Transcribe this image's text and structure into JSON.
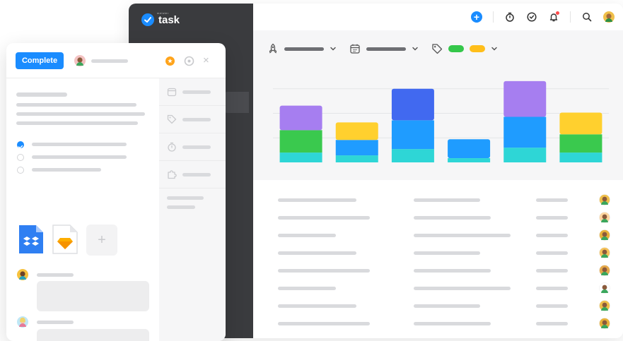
{
  "app": {
    "brand_prefix": "meister",
    "brand_name": "task"
  },
  "topbar": {
    "add_icon": "plus-circle-icon",
    "icons": [
      "timer-icon",
      "check-circle-icon",
      "bell-icon",
      "search-icon"
    ]
  },
  "filters": [
    {
      "icon": "rocket-icon"
    },
    {
      "icon": "calendar-icon"
    },
    {
      "icon": "tag-icon"
    }
  ],
  "chart_data": {
    "type": "bar",
    "stacked": true,
    "categories": [
      "",
      "",
      "",
      "",
      "",
      ""
    ],
    "series": [
      {
        "color": "#2ed6d6",
        "values": [
          14,
          10,
          19,
          6,
          21,
          14
        ]
      },
      {
        "color": "#3ac94e",
        "values": [
          32,
          0,
          0,
          0,
          0,
          26
        ]
      },
      {
        "color": "#1f9cff",
        "values": [
          0,
          22,
          41,
          27,
          44,
          0
        ]
      },
      {
        "color": "#ffd02e",
        "values": [
          0,
          25,
          0,
          0,
          0,
          31
        ]
      },
      {
        "color": "#a67ef0",
        "values": [
          35,
          0,
          0,
          0,
          51,
          0
        ]
      },
      {
        "color": "#4169f0",
        "values": [
          0,
          0,
          45,
          0,
          0,
          0
        ]
      }
    ],
    "ylim": [
      0,
      140
    ],
    "grid": true
  },
  "table": {
    "rows": [
      {
        "c1": 0.7,
        "c2": 0.62,
        "c3": 0.3,
        "avatar": "#f0c04a"
      },
      {
        "c1": 0.82,
        "c2": 0.72,
        "c3": 0.3,
        "avatar": "#ffd6a0"
      },
      {
        "c1": 0.52,
        "c2": 0.9,
        "c3": 0.3,
        "avatar": "#e8b23a"
      },
      {
        "c1": 0.7,
        "c2": 0.62,
        "c3": 0.3,
        "avatar": "#f5c25a"
      },
      {
        "c1": 0.82,
        "c2": 0.72,
        "c3": 0.3,
        "avatar": "#e6a94a"
      },
      {
        "c1": 0.52,
        "c2": 0.9,
        "c3": 0.3,
        "avatar": "#ffffff"
      },
      {
        "c1": 0.7,
        "c2": 0.62,
        "c3": 0.3,
        "avatar": "#f0c04a"
      },
      {
        "c1": 0.82,
        "c2": 0.72,
        "c3": 0.3,
        "avatar": "#e8b23a"
      }
    ]
  },
  "card": {
    "complete_label": "Complete",
    "checklist": [
      {
        "checked": true
      },
      {
        "checked": false
      },
      {
        "checked": false
      }
    ],
    "attachments": [
      "dropbox-file-icon",
      "sketch-file-icon"
    ],
    "add_attachment_label": "+",
    "close_label": "×",
    "properties": [
      "calendar-icon",
      "tag-icon",
      "timer-icon",
      "puzzle-icon"
    ]
  },
  "colors": {
    "accent": "#1a8cff",
    "sidebar": "#3a3b3e",
    "star": "#ffa41b"
  }
}
